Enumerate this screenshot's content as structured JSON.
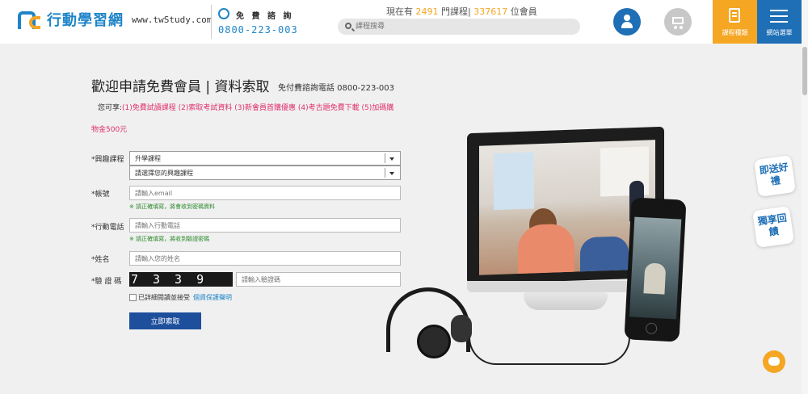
{
  "header": {
    "logo_text": "行動學習網",
    "logo_url": "www.twStudy.com",
    "phone_label": "免 費 諮 詢",
    "phone_number": "0800-223-003",
    "stats_prefix": "現在有",
    "course_count": "2491",
    "stats_middle": "門課程|",
    "member_count": "337617",
    "stats_suffix": "位會員",
    "search_placeholder": "課程搜尋",
    "course_menu_label": "課程種類",
    "site_menu_label": "網站選單"
  },
  "form": {
    "title": "歡迎申請免費會員 | 資料索取",
    "hotline": "免付費諮詢電話 0800-223-003",
    "benefits_prefix": "您可享:",
    "benefits_line1": "(1)免費試讀課程 (2)索取考試資料 (3)新會員首購優惠 (4)考古題免費下載 (5)加碼購",
    "benefits_line2": "物金500元",
    "interest_label": "*興趣課程",
    "interest_select1": "升學課程",
    "interest_select2": "請選擇您的興趣課程",
    "account_label": "*帳號",
    "account_placeholder": "請輸入email",
    "account_hint": "※ 請正確填寫，將會收到密碼資料",
    "mobile_label": "*行動電話",
    "mobile_placeholder": "請輸入行動電話",
    "mobile_hint": "※ 請正確填寫，將收到驗證密碼",
    "name_label": "*姓名",
    "name_placeholder": "請輸入您的姓名",
    "captcha_label": "*驗 證 碼",
    "captcha_code": "7339",
    "captcha_placeholder": "請輸入驗證碼",
    "agree_text": "已詳細閱讀並接受",
    "privacy_link": "個資保護聲明",
    "submit_label": "立即索取"
  },
  "side": {
    "promo1": "即送好禮",
    "promo2": "獨享回饋"
  },
  "colors": {
    "brand_blue": "#1e84c8",
    "navy": "#1e4f9c",
    "orange": "#f5a623",
    "pink": "#e0306e",
    "hint_green": "#2a8a2a"
  }
}
